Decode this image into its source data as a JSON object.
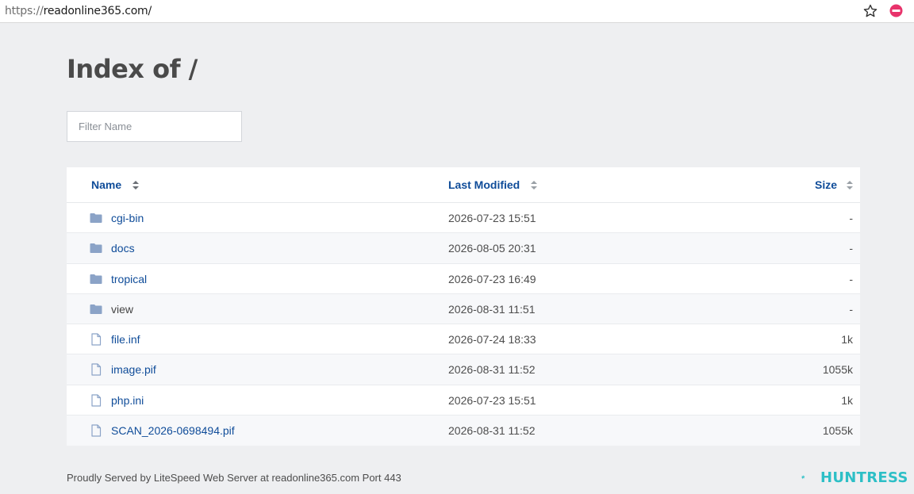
{
  "browser": {
    "url_scheme": "https://",
    "url_host": "readonline365.com/"
  },
  "page": {
    "title": "Index of /",
    "filter_placeholder": "Filter Name"
  },
  "table": {
    "headers": {
      "name": "Name",
      "modified": "Last Modified",
      "size": "Size"
    },
    "rows": [
      {
        "name": "cgi-bin",
        "modified": "2026-07-23 15:51",
        "size": "-",
        "type": "folder",
        "link": true
      },
      {
        "name": "docs",
        "modified": "2026-08-05 20:31",
        "size": "-",
        "type": "folder",
        "link": true
      },
      {
        "name": "tropical",
        "modified": "2026-07-23 16:49",
        "size": "-",
        "type": "folder",
        "link": true
      },
      {
        "name": "view",
        "modified": "2026-08-31 11:51",
        "size": "-",
        "type": "folder",
        "link": false
      },
      {
        "name": "file.inf",
        "modified": "2026-07-24 18:33",
        "size": "1k",
        "type": "file",
        "link": true
      },
      {
        "name": "image.pif",
        "modified": "2026-08-31 11:52",
        "size": "1055k",
        "type": "file",
        "link": true
      },
      {
        "name": "php.ini",
        "modified": "2026-07-23 15:51",
        "size": "1k",
        "type": "file",
        "link": true
      },
      {
        "name": "SCAN_2026-0698494.pif",
        "modified": "2026-08-31 11:52",
        "size": "1055k",
        "type": "file",
        "link": true
      }
    ]
  },
  "footer": {
    "text": "Proudly Served by LiteSpeed Web Server at readonline365.com Port 443"
  },
  "brand": {
    "name": "HUNTRESS"
  },
  "colors": {
    "link": "#0f4c99",
    "folder": "#8ba3c7",
    "brand": "#2dbfc6",
    "stop": "#e8336b"
  }
}
